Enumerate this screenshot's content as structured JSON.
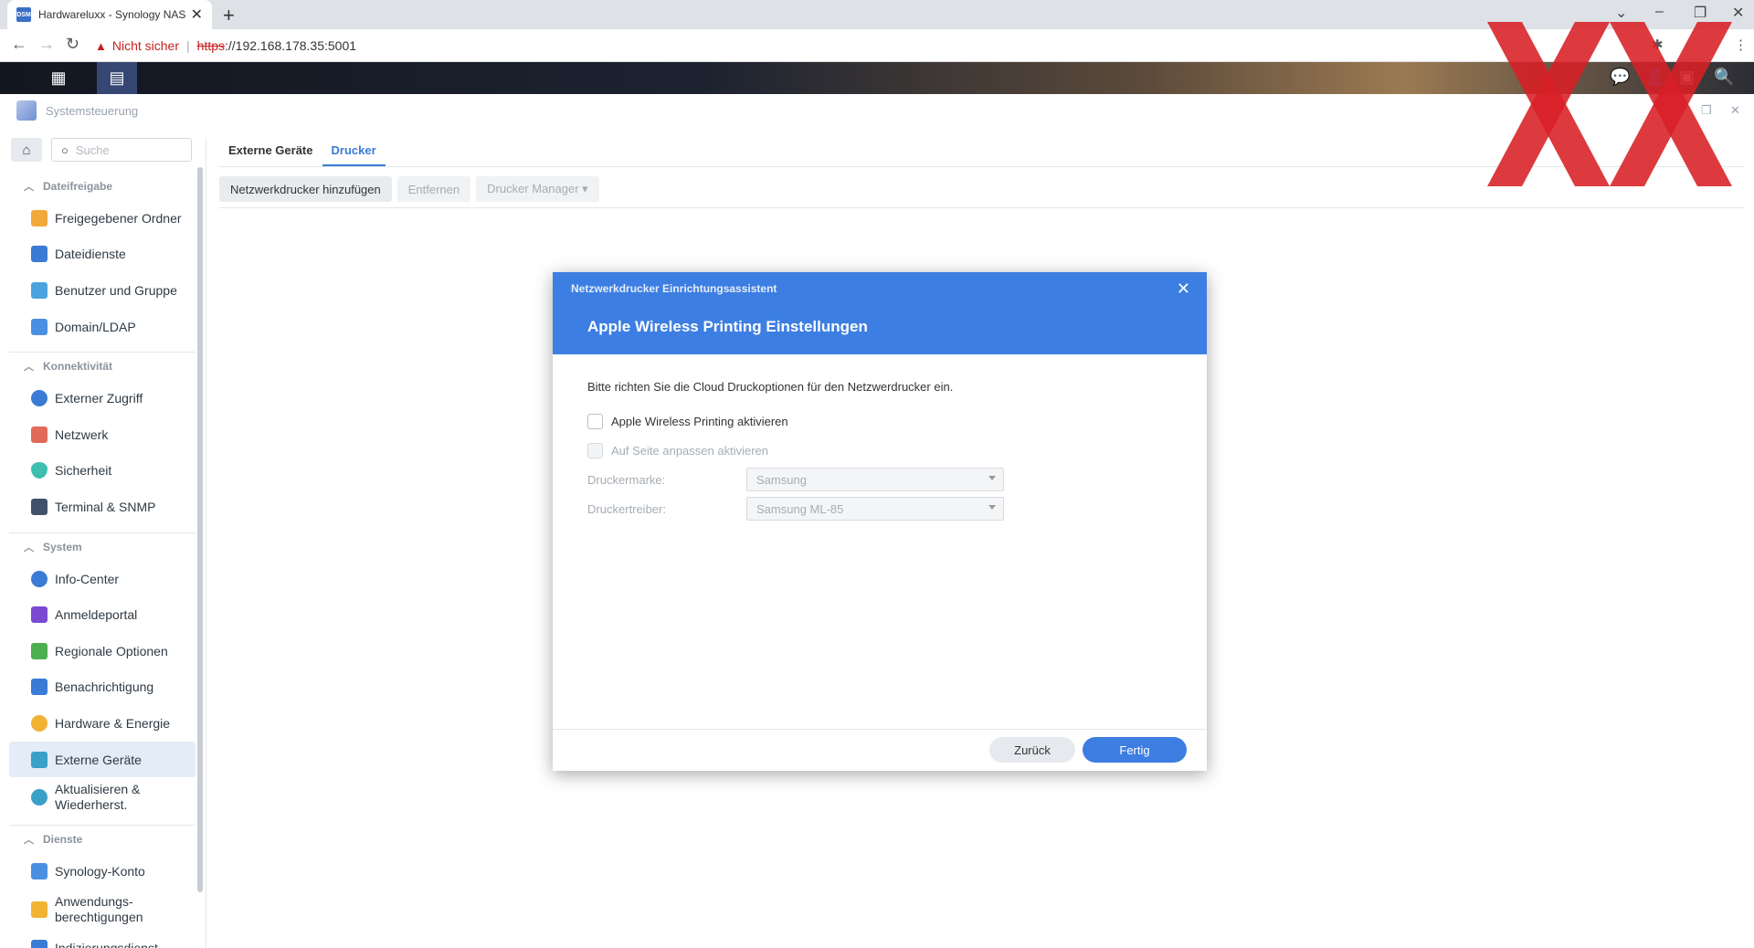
{
  "browser": {
    "tab_title": "Hardwareluxx - Synology NAS",
    "favicon_text": "DSM",
    "address": {
      "security_label": "Nicht sicher",
      "protocol": "https",
      "host": "://192.168.178.35:5001"
    }
  },
  "window": {
    "title": "Systemsteuerung"
  },
  "sidebar": {
    "search_placeholder": "Suche",
    "sections": [
      {
        "label": "Dateifreigabe",
        "items": [
          {
            "label": "Freigegebener Ordner",
            "color": "#f2a93b"
          },
          {
            "label": "Dateidienste",
            "color": "#3a7bd5"
          },
          {
            "label": "Benutzer und Gruppe",
            "color": "#4aa3df"
          },
          {
            "label": "Domain/LDAP",
            "color": "#4a90e2"
          }
        ]
      },
      {
        "label": "Konnektivität",
        "items": [
          {
            "label": "Externer Zugriff",
            "color": "#3a7bd5"
          },
          {
            "label": "Netzwerk",
            "color": "#e26a5a"
          },
          {
            "label": "Sicherheit",
            "color": "#3cbfae"
          },
          {
            "label": "Terminal & SNMP",
            "color": "#40526b"
          }
        ]
      },
      {
        "label": "System",
        "items": [
          {
            "label": "Info-Center",
            "color": "#3a7bd5"
          },
          {
            "label": "Anmeldeportal",
            "color": "#7a4bd0"
          },
          {
            "label": "Regionale Optionen",
            "color": "#4caf50"
          },
          {
            "label": "Benachrichtigung",
            "color": "#3a7bd5"
          },
          {
            "label": "Hardware & Energie",
            "color": "#f2b233"
          },
          {
            "label": "Externe Geräte",
            "color": "#3aa0c8"
          },
          {
            "label_line1": "Aktualisieren &",
            "label_line2": "Wiederherst.",
            "color": "#3aa0c8"
          }
        ]
      },
      {
        "label": "Dienste",
        "items": [
          {
            "label": "Synology-Konto",
            "color": "#4a90e2"
          },
          {
            "label_line1": "Anwendungs-",
            "label_line2": "berechtigungen",
            "color": "#f2b233"
          },
          {
            "label": "Indizierungsdienst",
            "color": "#3a7bd5"
          }
        ]
      }
    ]
  },
  "content": {
    "tabs": [
      "Externe Geräte",
      "Drucker"
    ],
    "active_tab": "Drucker",
    "toolbar": {
      "add": "Netzwerkdrucker hinzufügen",
      "remove": "Entfernen",
      "manager": "Drucker Manager ▾"
    }
  },
  "dialog": {
    "small_title": "Netzwerkdrucker Einrichtungsassistent",
    "title": "Apple Wireless Printing Einstellungen",
    "intro": "Bitte richten Sie die Cloud Druckoptionen für den Netzwerdrucker ein.",
    "checkbox_enable": "Apple Wireless Printing aktivieren",
    "checkbox_fit": "Auf Seite anpassen aktivieren",
    "brand_label": "Druckermarke:",
    "brand_value": "Samsung",
    "driver_label": "Druckertreiber:",
    "driver_value": "Samsung ML-85",
    "back_button": "Zurück",
    "done_button": "Fertig",
    "accent_color": "#3d7ee2"
  },
  "watermark": {
    "text": "XX",
    "color": "#d81f26"
  }
}
